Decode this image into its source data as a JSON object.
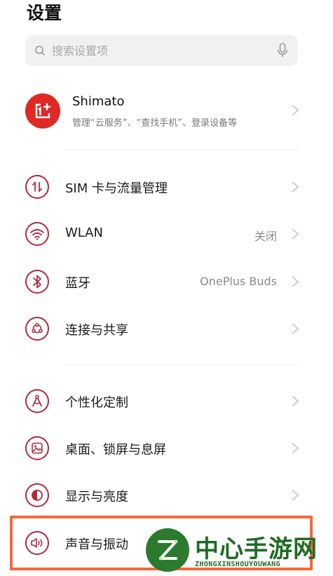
{
  "header": {
    "title": "设置"
  },
  "search": {
    "placeholder": "搜索设置项",
    "value": ""
  },
  "account": {
    "name": "Shimato",
    "subtitle": "管理“云服务”、“查找手机”、登录设备等",
    "avatar_color": "#e02925"
  },
  "accent_color": "#b02a3e",
  "sections": [
    {
      "items": [
        {
          "label": "SIM 卡与流量管理",
          "value": "",
          "icon": "sim-data-icon"
        },
        {
          "label": "WLAN",
          "value": "关闭",
          "icon": "wifi-icon"
        },
        {
          "label": "蓝牙",
          "value": "OnePlus Buds",
          "icon": "bluetooth-icon"
        },
        {
          "label": "连接与共享",
          "value": "",
          "icon": "share-icon"
        }
      ]
    },
    {
      "items": [
        {
          "label": "个性化定制",
          "value": "",
          "icon": "compass-icon"
        },
        {
          "label": "桌面、锁屏与息屏",
          "value": "",
          "icon": "wallpaper-icon"
        },
        {
          "label": "显示与亮度",
          "value": "",
          "icon": "brightness-icon"
        },
        {
          "label": "声音与振动",
          "value": "",
          "icon": "speaker-icon"
        }
      ]
    }
  ],
  "highlight_color": "#f06a3e",
  "watermark": {
    "title": "中心手游网",
    "subtitle": "ZHONGXINSHOUYOUWANG",
    "color": "#1f6b25"
  }
}
